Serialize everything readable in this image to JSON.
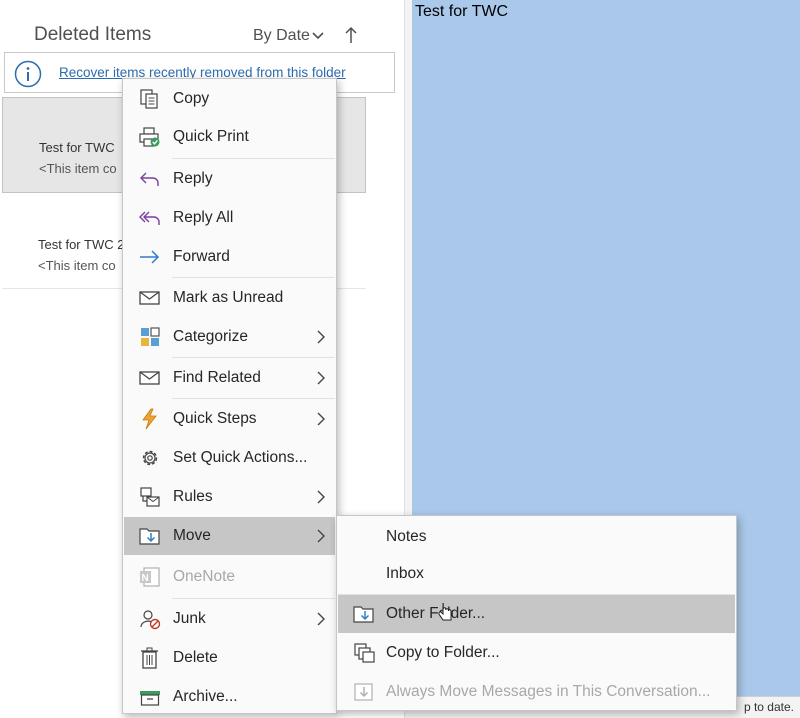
{
  "list_pane": {
    "folder_title": "Deleted Items",
    "sort_label": "By Date",
    "sort_chevron_icon": "chevron-down-icon",
    "sort_direction_icon": "arrow-up-icon",
    "info_bar": {
      "icon": "info-icon",
      "link_text": "Recover items recently removed from this folder"
    },
    "messages": [
      {
        "subject": "Test for TWC",
        "preview": "<This item co",
        "selected": true
      },
      {
        "subject": "Test for TWC 2",
        "preview": "<This item co",
        "selected": false
      }
    ]
  },
  "reading_pane": {
    "title": "Test for TWC",
    "status_text": "p to date."
  },
  "context_menu": {
    "items": [
      {
        "label": "Copy",
        "icon": "copy-icon",
        "submenu": false
      },
      {
        "label": "Quick Print",
        "icon": "quick-print-icon",
        "submenu": false
      },
      {
        "label": "Reply",
        "icon": "reply-icon",
        "submenu": false
      },
      {
        "label": "Reply All",
        "icon": "reply-all-icon",
        "submenu": false
      },
      {
        "label": "Forward",
        "icon": "forward-icon",
        "submenu": false
      },
      {
        "label": "Mark as Unread",
        "icon": "envelope-icon",
        "submenu": false
      },
      {
        "label": "Categorize",
        "icon": "categorize-icon",
        "submenu": true
      },
      {
        "label": "Find Related",
        "icon": "find-related-icon",
        "submenu": true
      },
      {
        "label": "Quick Steps",
        "icon": "lightning-icon",
        "submenu": true
      },
      {
        "label": "Set Quick Actions...",
        "icon": "gear-icon",
        "submenu": false
      },
      {
        "label": "Rules",
        "icon": "rules-icon",
        "submenu": true
      },
      {
        "label": "Move",
        "icon": "move-icon",
        "submenu": true,
        "highlighted": true
      },
      {
        "label": "OneNote",
        "icon": "onenote-icon",
        "submenu": false,
        "disabled": true
      },
      {
        "label": "Junk",
        "icon": "junk-icon",
        "submenu": true
      },
      {
        "label": "Delete",
        "icon": "trash-icon",
        "submenu": false
      },
      {
        "label": "Archive...",
        "icon": "archive-icon",
        "submenu": false
      }
    ]
  },
  "move_submenu": {
    "items": [
      {
        "label": "Notes",
        "icon": ""
      },
      {
        "label": "Inbox",
        "icon": ""
      },
      {
        "label": "Other Folder...",
        "icon": "move-to-folder-icon",
        "highlighted": true
      },
      {
        "label": "Copy to Folder...",
        "icon": "copy-to-folder-icon"
      },
      {
        "label": "Always Move Messages in This Conversation...",
        "icon": "always-move-icon",
        "disabled": true
      }
    ]
  },
  "colors": {
    "reading_pane_bg": "#a9c8ea",
    "link": "#2b6cb0",
    "menu_highlight": "#c6c6c6",
    "reply_purple": "#7b3fa0",
    "forward_blue": "#2f7dc9"
  }
}
